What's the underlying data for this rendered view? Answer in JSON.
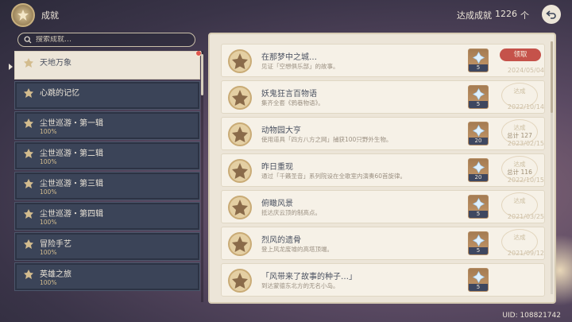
{
  "header": {
    "title": "成就",
    "total_label": "达成成就",
    "total_count": "1226",
    "total_unit": "个"
  },
  "search": {
    "placeholder": "搜索成就…"
  },
  "categories": [
    {
      "name": "天地万象",
      "percent": "",
      "active": true,
      "notification": true
    },
    {
      "name": "心跳的记忆",
      "percent": ""
    },
    {
      "name": "尘世巡游・第一辑",
      "percent": "100%"
    },
    {
      "name": "尘世巡游・第二辑",
      "percent": "100%"
    },
    {
      "name": "尘世巡游・第三辑",
      "percent": "100%"
    },
    {
      "name": "尘世巡游・第四辑",
      "percent": "100%"
    },
    {
      "name": "冒险手艺",
      "percent": "100%"
    },
    {
      "name": "英雄之旅",
      "percent": "100%"
    }
  ],
  "achievements": [
    {
      "title": "在那梦中之城…",
      "desc": "见证「空想俱乐部」的故事。",
      "reward": "5",
      "action": "领取",
      "date": "2024/05/04"
    },
    {
      "title": "妖鬼狂言百物语",
      "desc": "集齐全套《鸦巷物语》。",
      "reward": "5",
      "stamp": "达成",
      "date": "2022/10/14"
    },
    {
      "title": "动物园大亨",
      "desc": "使用道具「四方八方之网」捕获100只野外生物。",
      "reward": "20",
      "stamp": "达成",
      "total": "总计 127",
      "date": "2023/02/15"
    },
    {
      "title": "昨日重现",
      "desc": "通过「千籁圣音」系列院设在全歌室内演奏60首旋律。",
      "reward": "20",
      "stamp": "达成",
      "total": "总计 116",
      "date": "2022/10/15"
    },
    {
      "title": "俯瞰风景",
      "desc": "抵达庆云顶的制高点。",
      "reward": "5",
      "stamp": "达成",
      "date": "2021/03/25"
    },
    {
      "title": "烈风的遗骨",
      "desc": "登上风龙废墟的高塔顶端。",
      "reward": "5",
      "stamp": "达成",
      "date": "2021/09/12"
    },
    {
      "title": "「风带来了故事的种子…」",
      "desc": "到达蒙德东北方的无名小岛。",
      "reward": "5",
      "stamp": "",
      "date": ""
    }
  ],
  "uid": "UID: 108821742",
  "colors": {
    "panel": "#ece5d8",
    "category": "#3b4458",
    "accent": "#d3bc8e",
    "claim": "#c5524a"
  }
}
